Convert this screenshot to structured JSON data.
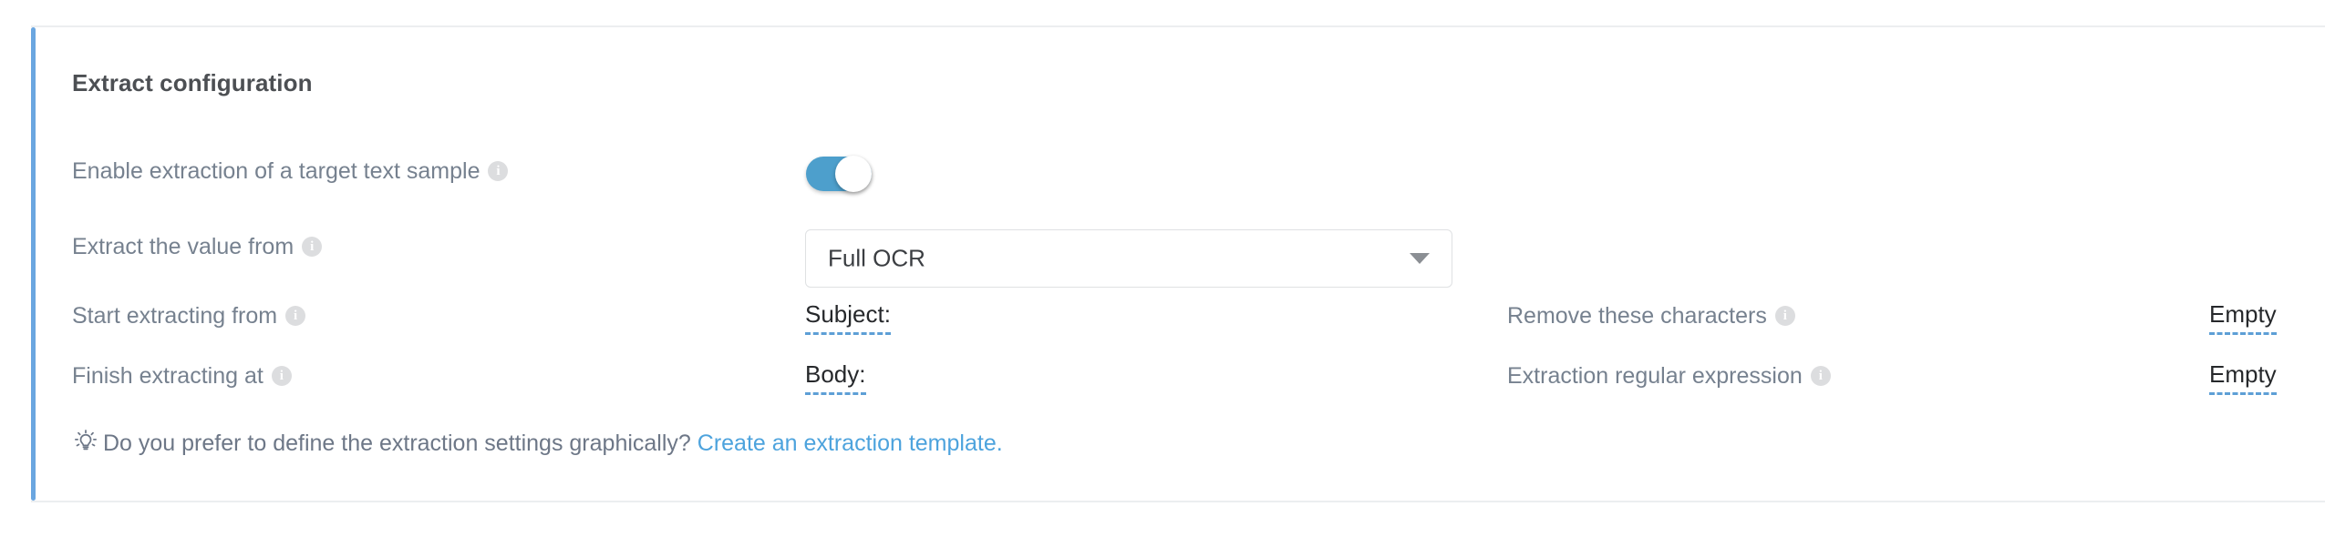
{
  "card": {
    "title": "Extract configuration",
    "accent_color": "#6aa6e0"
  },
  "fields": {
    "enable_extraction": {
      "label": "Enable extraction of a target text sample",
      "info_icon": "info-icon",
      "toggle_state": "on",
      "toggle_color": "#4d9fcc"
    },
    "extract_value_from": {
      "label": "Extract the value from",
      "info_icon": "info-icon",
      "selected": "Full OCR",
      "arrow_icon": "chevron-down-icon"
    },
    "start_extracting_from": {
      "label": "Start extracting from",
      "info_icon": "info-icon",
      "value": "Subject:"
    },
    "finish_extracting_at": {
      "label": "Finish extracting at",
      "info_icon": "info-icon",
      "value": "Body:"
    },
    "remove_these_characters": {
      "label": "Remove these characters",
      "info_icon": "info-icon",
      "value": "Empty"
    },
    "extraction_regular_expression": {
      "label": "Extraction regular expression",
      "info_icon": "info-icon",
      "value": "Empty"
    }
  },
  "hint": {
    "icon": "lightbulb-icon",
    "text": "Do you prefer to define the extraction settings graphically?",
    "link_text": "Create an extraction template.",
    "link_color": "#4da3dd"
  }
}
